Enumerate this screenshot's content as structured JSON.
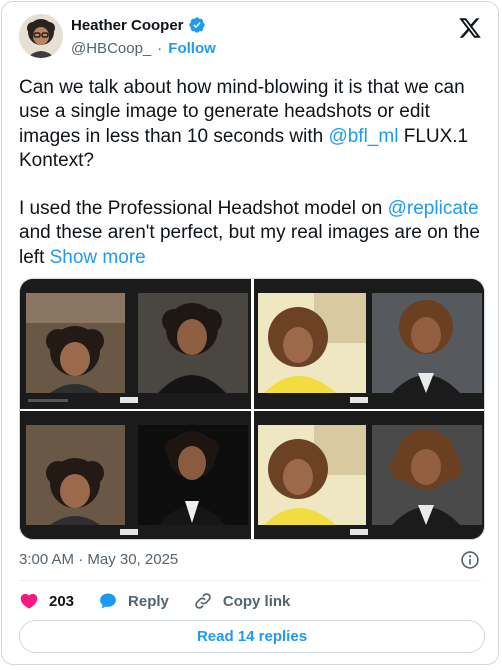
{
  "author": {
    "name": "Heather Cooper",
    "handle": "@HBCoop_",
    "separator": "·",
    "follow_label": "Follow"
  },
  "tweet": {
    "paragraph1_before": "Can we talk about how mind-blowing it is that we can use a single image to generate headshots or edit images in less than 10 seconds with ",
    "mention_bfl": "@bfl_ml",
    "paragraph1_after": " FLUX.1 Kontext?",
    "paragraph2_before": "I used the Professional Headshot model on ",
    "mention_replicate": "@replicate",
    "paragraph2_after": " and these aren't perfect, but my real images are on the left ",
    "show_more": "Show more"
  },
  "media": {
    "image_count": 4
  },
  "meta": {
    "timestamp": "3:00 AM · May 30, 2025"
  },
  "actions": {
    "likes": "203",
    "reply_label": "Reply",
    "copy_link_label": "Copy link"
  },
  "read_replies_label": "Read 14 replies",
  "colors": {
    "accent": "#1d9bf0",
    "like": "#f91880",
    "muted": "#536471"
  },
  "icons": [
    "verified-badge-icon",
    "x-logo-icon",
    "info-icon",
    "heart-icon",
    "reply-bubble-icon",
    "link-icon"
  ]
}
